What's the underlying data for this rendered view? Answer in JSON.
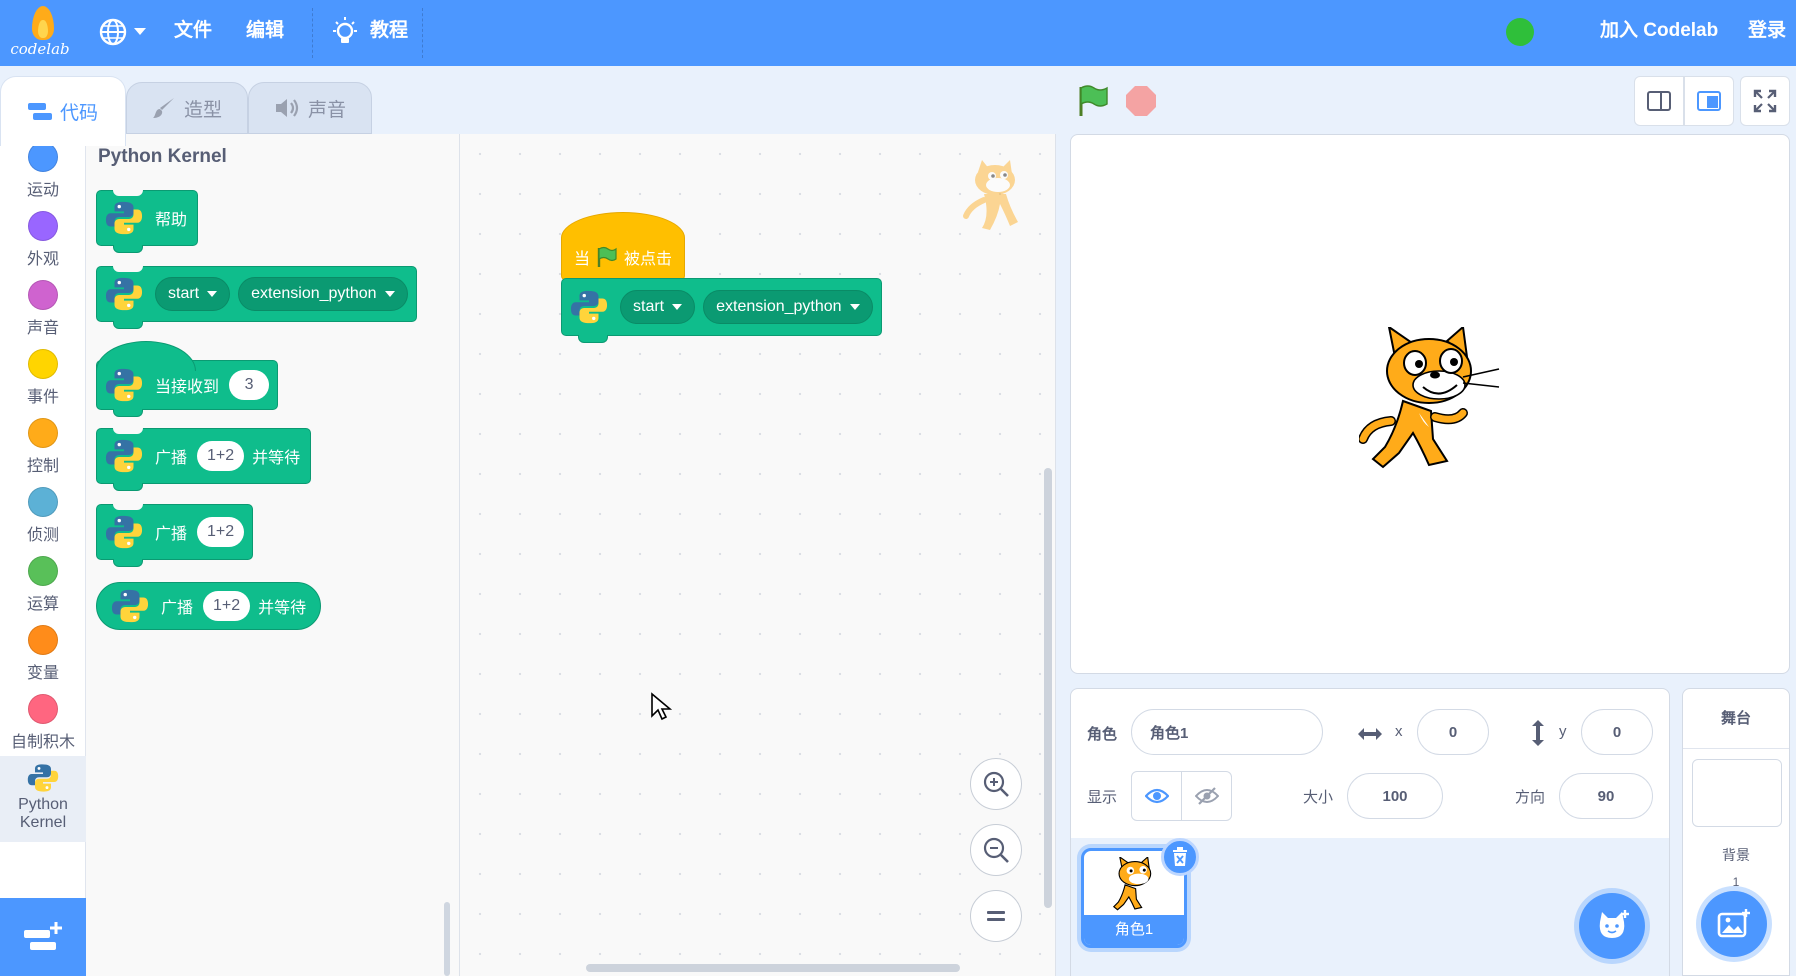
{
  "menubar": {
    "logo_text": "codelab",
    "file": "文件",
    "edit": "编辑",
    "tutorials": "教程",
    "join": "加入 Codelab",
    "login": "登录"
  },
  "tabs": {
    "code": "代码",
    "costumes": "造型",
    "sounds": "声音"
  },
  "categories": [
    {
      "label": "运动",
      "color": "#4c97ff"
    },
    {
      "label": "外观",
      "color": "#9966ff"
    },
    {
      "label": "声音",
      "color": "#cf63cf"
    },
    {
      "label": "事件",
      "color": "#ffd500"
    },
    {
      "label": "控制",
      "color": "#ffab19"
    },
    {
      "label": "侦测",
      "color": "#5cb1d6"
    },
    {
      "label": "运算",
      "color": "#59c059"
    },
    {
      "label": "变量",
      "color": "#ff8c1a"
    },
    {
      "label": "自制积木",
      "color": "#ff6680"
    },
    {
      "label_line1": "Python",
      "label_line2": "Kernel"
    }
  ],
  "flyout": {
    "title": "Python Kernel",
    "help": "帮助",
    "start": "start",
    "extension": "extension_python",
    "when_receive": "当接收到",
    "receive_value": "3",
    "broadcast": "广播",
    "broadcast_value": "1+2",
    "and_wait": "并等待"
  },
  "workspace": {
    "when": "当",
    "clicked": "被点击",
    "start": "start",
    "extension": "extension_python"
  },
  "sprite_info": {
    "sprite_label": "角色",
    "sprite_name": "角色1",
    "x_label": "x",
    "x_value": "0",
    "y_label": "y",
    "y_value": "0",
    "show_label": "显示",
    "size_label": "大小",
    "size_value": "100",
    "direction_label": "方向",
    "direction_value": "90",
    "thumb_name": "角色1"
  },
  "stage_panel": {
    "title": "舞台",
    "backdrops_label": "背景",
    "backdrop_count": "1"
  },
  "colors": {
    "accent": "#4c97ff",
    "python_block": "#0fbd8c",
    "event_block": "#ffbf00"
  }
}
